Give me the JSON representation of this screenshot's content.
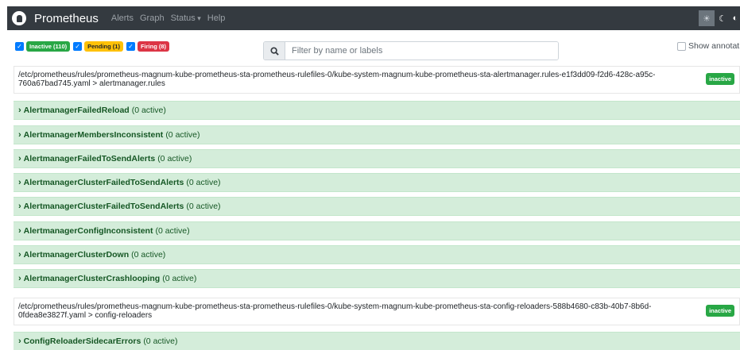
{
  "navbar": {
    "brand": "Prometheus",
    "links": [
      "Alerts",
      "Graph",
      "Status",
      "Help"
    ],
    "theme_icons": [
      "sun-icon",
      "moon-icon",
      "contrast-icon"
    ]
  },
  "filters": {
    "inactive": "Inactive (110)",
    "pending": "Pending (1)",
    "firing": "Firing (8)"
  },
  "search": {
    "placeholder": "Filter by name or labels"
  },
  "show_annotations": "Show annotations",
  "groups": [
    {
      "path": "/etc/prometheus/rules/prometheus-magnum-kube-prometheus-sta-prometheus-rulefiles-0/kube-system-magnum-kube-prometheus-sta-alertmanager.rules-e1f3dd09-f2d6-428c-a95c-760a67bad745.yaml > alertmanager.rules",
      "state": "inactive",
      "rules": [
        {
          "name": "AlertmanagerFailedReload",
          "count": "(0 active)"
        },
        {
          "name": "AlertmanagerMembersInconsistent",
          "count": "(0 active)"
        },
        {
          "name": "AlertmanagerFailedToSendAlerts",
          "count": "(0 active)"
        },
        {
          "name": "AlertmanagerClusterFailedToSendAlerts",
          "count": "(0 active)"
        },
        {
          "name": "AlertmanagerClusterFailedToSendAlerts",
          "count": "(0 active)"
        },
        {
          "name": "AlertmanagerConfigInconsistent",
          "count": "(0 active)"
        },
        {
          "name": "AlertmanagerClusterDown",
          "count": "(0 active)"
        },
        {
          "name": "AlertmanagerClusterCrashlooping",
          "count": "(0 active)"
        }
      ]
    },
    {
      "path": "/etc/prometheus/rules/prometheus-magnum-kube-prometheus-sta-prometheus-rulefiles-0/kube-system-magnum-kube-prometheus-sta-config-reloaders-588b4680-c83b-40b7-8b6d-0fdea8e3827f.yaml > config-reloaders",
      "state": "inactive",
      "rules": [
        {
          "name": "ConfigReloaderSidecarErrors",
          "count": "(0 active)"
        }
      ]
    }
  ],
  "colors": {
    "navbar_bg": "#343a40",
    "inactive": "#28a745",
    "pending": "#ffc107",
    "firing": "#dc3545",
    "rule_bg": "#d4edda",
    "rule_text": "#155724",
    "checkbox": "#007bff"
  }
}
